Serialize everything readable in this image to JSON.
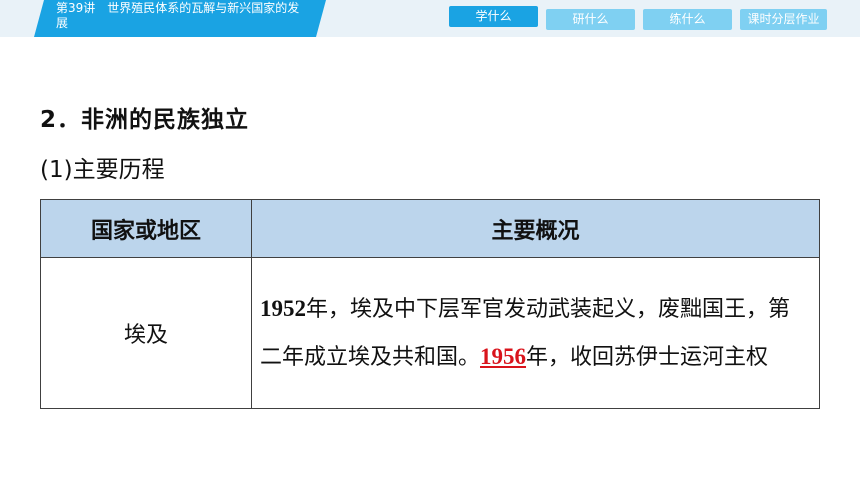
{
  "header": {
    "lesson_title": "第39讲　世界殖民体系的瓦解与新兴国家的发展",
    "nav": [
      "学什么",
      "研什么",
      "练什么",
      "课时分层作业"
    ],
    "active_nav_index": 0
  },
  "content": {
    "section_heading": "2．非洲的民族独立",
    "sub_heading": "(1)主要历程"
  },
  "table": {
    "headers": [
      "国家或地区",
      "主要概况"
    ],
    "rows": [
      {
        "country": "埃及",
        "year1": "1952",
        "text1": "年，埃及中下层军官发动武装起义，废黜国王，第二年成立埃及共和国。",
        "answer": "1956",
        "text2": "年，收回苏伊士运河主权"
      }
    ]
  },
  "colors": {
    "accent_blue": "#1aa3e3",
    "light_blue": "#7fd0f2",
    "table_header_bg": "#bcd5ec",
    "answer_red": "#d9141c"
  }
}
